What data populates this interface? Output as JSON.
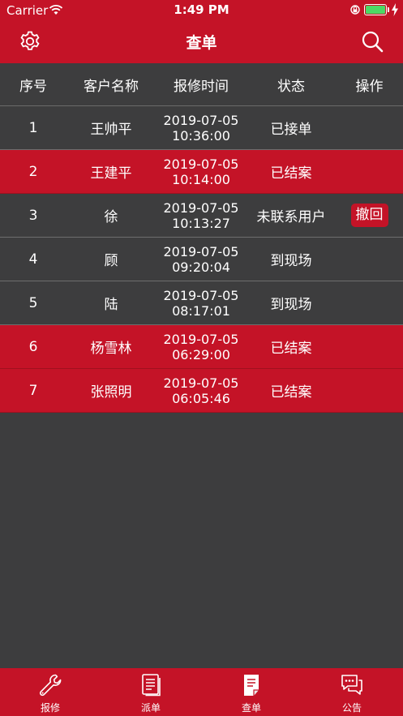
{
  "status_bar": {
    "carrier": "Carrier",
    "time": "1:49 PM"
  },
  "nav": {
    "title": "查单",
    "settings_icon": "gear-icon",
    "search_icon": "search-icon"
  },
  "table": {
    "headers": [
      "序号",
      "客户名称",
      "报修时间",
      "状态",
      "操作"
    ],
    "rows": [
      {
        "no": "1",
        "name": "王帅平",
        "date": "2019-07-05",
        "time": "10:36:00",
        "status": "已接单",
        "action": "",
        "highlight": false
      },
      {
        "no": "2",
        "name": "王建平",
        "date": "2019-07-05",
        "time": "10:14:00",
        "status": "已结案",
        "action": "",
        "highlight": true
      },
      {
        "no": "3",
        "name": "徐",
        "date": "2019-07-05",
        "time": "10:13:27",
        "status": "未联系用户",
        "action": "撤回",
        "highlight": false
      },
      {
        "no": "4",
        "name": "顾",
        "date": "2019-07-05",
        "time": "09:20:04",
        "status": "到现场",
        "action": "",
        "highlight": false
      },
      {
        "no": "5",
        "name": "陆",
        "date": "2019-07-05",
        "time": "08:17:01",
        "status": "到现场",
        "action": "",
        "highlight": false
      },
      {
        "no": "6",
        "name": "杨雪林",
        "date": "2019-07-05",
        "time": "06:29:00",
        "status": "已结案",
        "action": "",
        "highlight": true
      },
      {
        "no": "7",
        "name": "张照明",
        "date": "2019-07-05",
        "time": "06:05:46",
        "status": "已结案",
        "action": "",
        "highlight": true
      }
    ]
  },
  "tabs": [
    {
      "label": "报修",
      "icon": "wrench-icon",
      "active": false
    },
    {
      "label": "派单",
      "icon": "document-icon",
      "active": false
    },
    {
      "label": "查单",
      "icon": "document-filled-icon",
      "active": true
    },
    {
      "label": "公告",
      "icon": "chat-bubbles-icon",
      "active": false
    }
  ],
  "colors": {
    "brand_red": "#c41327",
    "background": "#3d3d3e",
    "battery_green": "#4cd964"
  }
}
